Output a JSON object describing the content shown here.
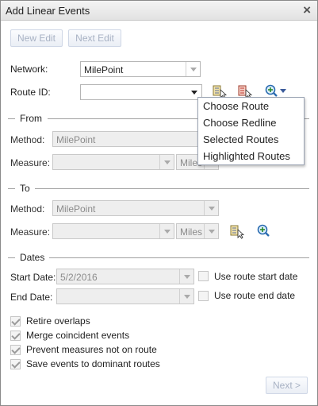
{
  "window": {
    "title": "Add Linear Events",
    "close_glyph": "×"
  },
  "toolbar": {
    "new_edit": "New Edit",
    "next_edit": "Next Edit"
  },
  "network": {
    "label": "Network:",
    "value": "MilePoint"
  },
  "route": {
    "label": "Route ID:",
    "value": ""
  },
  "route_menu": {
    "items": [
      "Choose Route",
      "Choose Redline",
      "Selected Routes",
      "Highlighted Routes"
    ]
  },
  "from": {
    "heading": "From",
    "method_label": "Method:",
    "method_value": "MilePoint",
    "measure_label": "Measure:",
    "measure_value": "",
    "units_value": "Miles"
  },
  "to": {
    "heading": "To",
    "method_label": "Method:",
    "method_value": "MilePoint",
    "measure_label": "Measure:",
    "measure_value": "",
    "units_value": "Miles"
  },
  "dates": {
    "heading": "Dates",
    "start_label": "Start Date:",
    "start_value": "5/2/2016",
    "end_label": "End Date:",
    "end_value": "",
    "use_start": "Use route start date",
    "use_end": "Use route end date"
  },
  "options": [
    {
      "label": "Retire overlaps",
      "checked": true
    },
    {
      "label": "Merge coincident events",
      "checked": true
    },
    {
      "label": "Prevent measures not on route",
      "checked": true
    },
    {
      "label": "Save events to dominant routes",
      "checked": true
    }
  ],
  "footer": {
    "next": "Next >"
  },
  "icons": {
    "select_route": "select-route-icon",
    "redline": "redline-select-icon",
    "zoom": "zoom-in-icon"
  }
}
